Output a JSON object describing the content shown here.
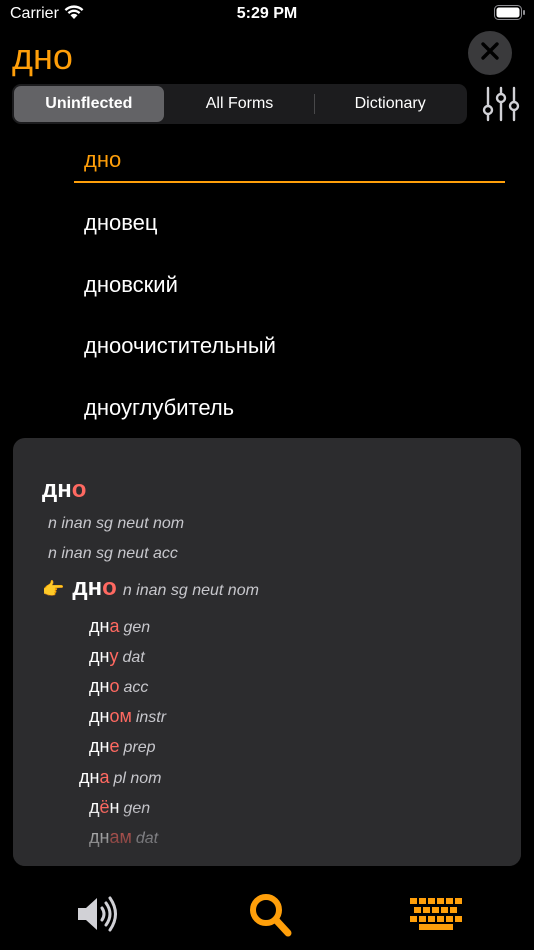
{
  "status_bar": {
    "carrier": "Carrier",
    "time": "5:29 PM"
  },
  "header": {
    "search_word": "дно"
  },
  "segments": [
    {
      "label": "Uninflected",
      "selected": true
    },
    {
      "label": "All Forms",
      "selected": false
    },
    {
      "label": "Dictionary",
      "selected": false
    }
  ],
  "word_list": [
    "дно",
    "дновец",
    "дновский",
    "дноочистительный",
    "дноуглубитель"
  ],
  "panel": {
    "lemma": {
      "stem": "дн",
      "ending": "о"
    },
    "lemma_tags": [
      "n inan sg neut nom",
      "n inan sg neut acc"
    ],
    "pointer": {
      "icon": "👉",
      "stem": "дн",
      "ending": "о",
      "tag": "n inan sg neut nom"
    },
    "forms": [
      {
        "stem": "дн",
        "ending": "а",
        "tag": "gen"
      },
      {
        "stem": "дн",
        "ending": "у",
        "tag": "dat"
      },
      {
        "stem": "дн",
        "ending": "о",
        "tag": "acc"
      },
      {
        "stem": "дн",
        "ending": "ом",
        "tag": "instr"
      },
      {
        "stem": "дн",
        "ending": "е",
        "tag": "prep"
      },
      {
        "stem": "дн",
        "ending": "а",
        "tag": "pl nom"
      },
      {
        "stem": "д",
        "ending": "ё",
        "tail": "н",
        "tag": "gen"
      },
      {
        "stem": "дн",
        "ending": "ам",
        "tag": "dat"
      }
    ]
  },
  "colors": {
    "accent": "#ff9f0a",
    "ending": "#ff6961",
    "panel": "#2c2c2e"
  },
  "icons": {
    "close": "close-icon",
    "filter": "sliders-icon",
    "speaker": "speaker-icon",
    "search": "magnifier-icon",
    "keyboard": "keyboard-icon"
  }
}
